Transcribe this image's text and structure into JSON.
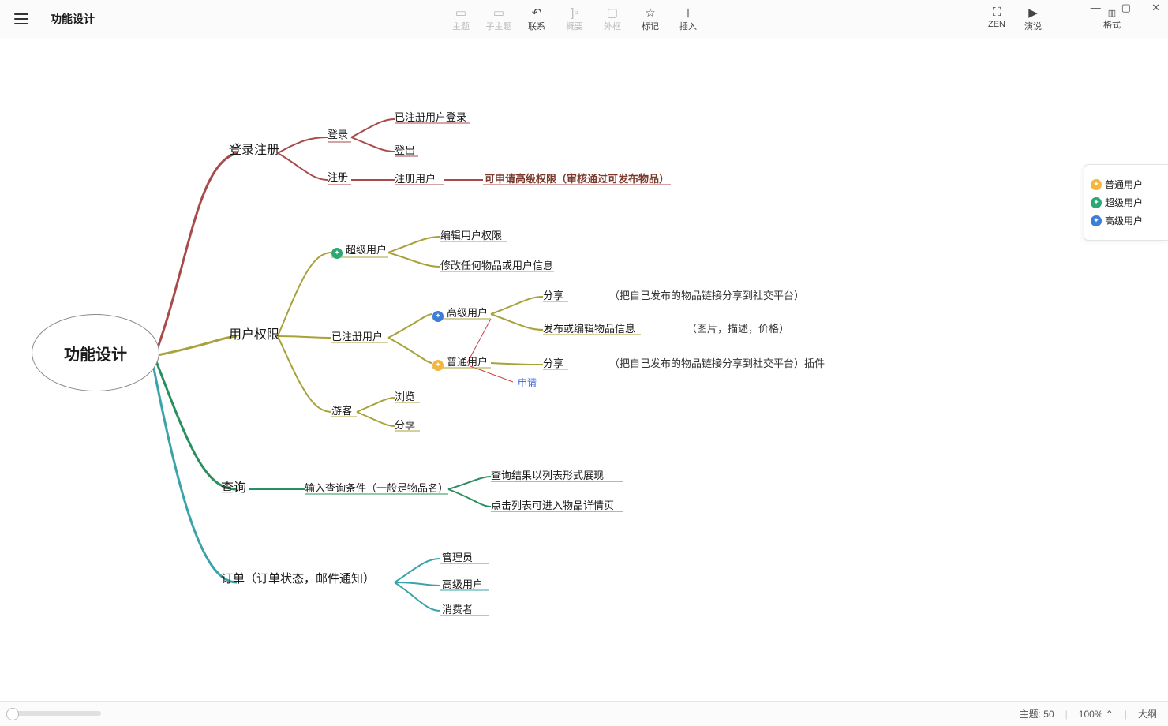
{
  "doc_title": "功能设计",
  "toolbar": {
    "topic": "主题",
    "subtopic": "子主题",
    "relation": "联系",
    "summary": "概要",
    "boundary": "外框",
    "marker": "标记",
    "insert": "插入",
    "zen": "ZEN",
    "present": "演说",
    "format": "格式"
  },
  "legend": {
    "normal_user": "普通用户",
    "super_user": "超级用户",
    "advanced_user": "高级用户"
  },
  "statusbar": {
    "topic_count_label": "主题: 50",
    "zoom": "100%",
    "outline": "大纲"
  },
  "mindmap": {
    "root": "功能设计",
    "branches": [
      {
        "label": "登录注册",
        "color": "#a84a4a",
        "children": [
          {
            "label": "登录",
            "children": [
              {
                "label": "已注册用户登录"
              },
              {
                "label": "登出"
              }
            ]
          },
          {
            "label": "注册",
            "children": [
              {
                "label": "注册用户",
                "note": "可申请高级权限（审核通过可发布物品）",
                "note_color": "#7a3a2e"
              }
            ]
          }
        ]
      },
      {
        "label": "用户权限",
        "color": "#a8a23b",
        "children": [
          {
            "label": "超级用户",
            "badge": "green",
            "children": [
              {
                "label": "编辑用户权限"
              },
              {
                "label": "修改任何物品或用户信息"
              }
            ]
          },
          {
            "label": "已注册用户",
            "children": [
              {
                "label": "高级用户",
                "badge": "blue",
                "children": [
                  {
                    "label": "分享",
                    "note": "（把自己发布的物品链接分享到社交平台）"
                  },
                  {
                    "label": "发布或编辑物品信息",
                    "note": "（图片，描述，价格）"
                  }
                ]
              },
              {
                "label": "普通用户",
                "badge": "yellow",
                "children": [
                  {
                    "label": "分享",
                    "note": "（把自己发布的物品链接分享到社交平台）插件"
                  }
                ]
              }
            ]
          },
          {
            "label": "游客",
            "children": [
              {
                "label": "浏览"
              },
              {
                "label": "分享"
              }
            ]
          }
        ],
        "relationship": {
          "from": "普通用户",
          "to": "高级用户",
          "label": "申请",
          "label_color": "#2e5bd8"
        }
      },
      {
        "label": "查询",
        "color": "#2a8f5e",
        "children": [
          {
            "label": "输入查询条件（一般是物品名）",
            "children": [
              {
                "label": "查询结果以列表形式展现"
              },
              {
                "label": "点击列表可进入物品详情页"
              }
            ]
          }
        ]
      },
      {
        "label": "订单（订单状态，邮件通知）",
        "color": "#3aa3a9",
        "children": [
          {
            "label": "管理员"
          },
          {
            "label": "高级用户"
          },
          {
            "label": "消费者"
          }
        ]
      }
    ]
  }
}
